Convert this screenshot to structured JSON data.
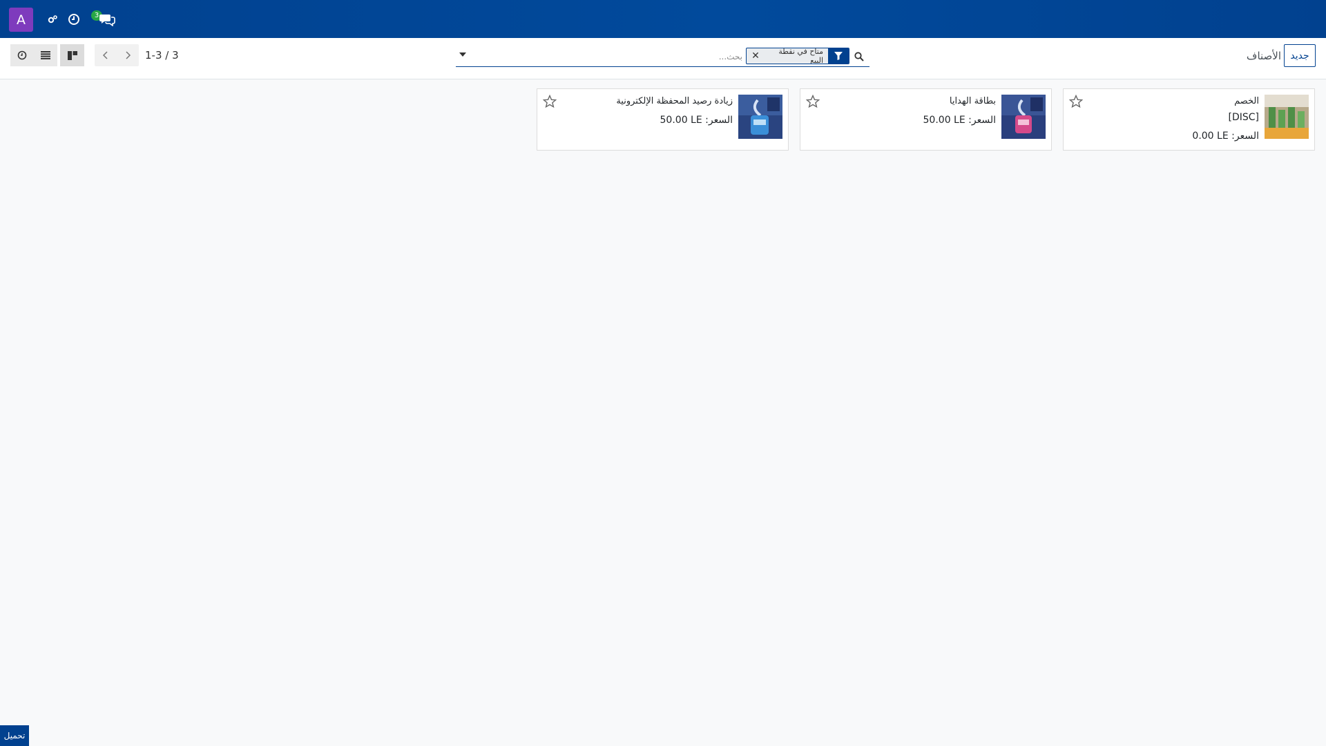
{
  "navbar": {
    "avatar_letter": "A",
    "messages_count": "3",
    "icons": [
      "avatar",
      "cogs-icon",
      "clock-icon",
      "chat-icon"
    ]
  },
  "control_panel": {
    "new_button": "جديد",
    "breadcrumb": "الأصناف",
    "search": {
      "placeholder": "بحث...",
      "facet_label": "متاح في نقطة البيع"
    },
    "pager": "1-3 / 3"
  },
  "cards": [
    {
      "title": "الخصم",
      "code": "[DISC]",
      "price_label": "السعر:",
      "price": "0.00 LE",
      "image_theme": "green"
    },
    {
      "title": "بطاقة الهدايا",
      "code": "",
      "price_label": "السعر:",
      "price": "50.00 LE",
      "image_theme": "pink"
    },
    {
      "title": "زيادة رصيد المحفظة الإلكترونية",
      "code": "",
      "price_label": "السعر:",
      "price": "50.00 LE",
      "image_theme": "blue"
    }
  ],
  "footer": {
    "load_label": "تحميل"
  },
  "colors": {
    "brand": "#01418f",
    "avatar": "#7e3bbd",
    "badge": "#28a745"
  }
}
